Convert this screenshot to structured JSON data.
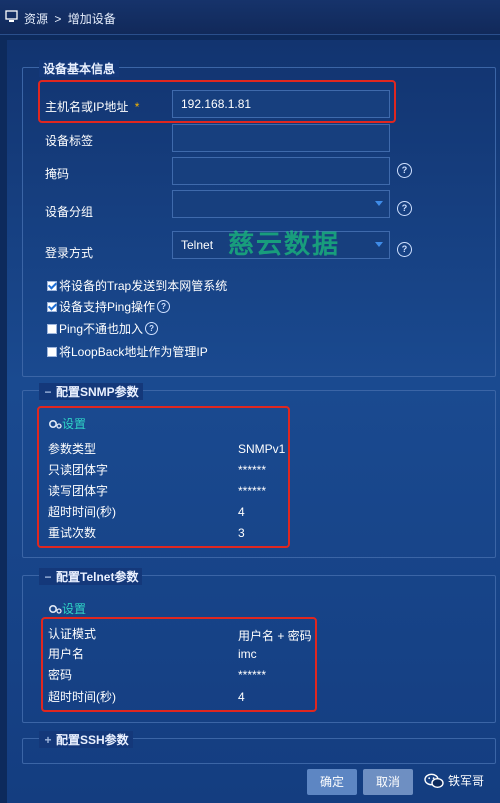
{
  "breadcrumb": {
    "root": "资源",
    "separator": ">",
    "current": "增加设备"
  },
  "basic_info": {
    "legend": "设备基本信息",
    "fields": [
      {
        "label": "主机名或IP地址",
        "required_mark": "*",
        "value": "192.168.1.81"
      },
      {
        "label": "设备标签",
        "value": ""
      },
      {
        "label": "掩码",
        "value": ""
      },
      {
        "label": "设备分组",
        "value": ""
      },
      {
        "label": "登录方式",
        "value": "Telnet"
      }
    ],
    "options": [
      {
        "label": "将设备的Trap发送到本网管系统",
        "checked": true
      },
      {
        "label": "设备支持Ping操作",
        "checked": true
      },
      {
        "label": "Ping不通也加入",
        "checked": false
      },
      {
        "label": "将LoopBack地址作为管理IP",
        "checked": false
      }
    ]
  },
  "snmp": {
    "legend": "配置SNMP参数",
    "toggle": "−",
    "settings_label": "设置",
    "rows": [
      {
        "key": "参数类型",
        "value": "SNMPv1"
      },
      {
        "key": "只读团体字",
        "value": "******"
      },
      {
        "key": "读写团体字",
        "value": "******"
      },
      {
        "key": "超时时间(秒)",
        "value": "4"
      },
      {
        "key": "重试次数",
        "value": "3"
      }
    ]
  },
  "telnet": {
    "legend": "配置Telnet参数",
    "toggle": "−",
    "settings_label": "设置",
    "rows": [
      {
        "key": "认证模式",
        "value": "用户名 + 密码"
      },
      {
        "key": "用户名",
        "value": "imc"
      },
      {
        "key": "密码",
        "value": "******"
      },
      {
        "key": "超时时间(秒)",
        "value": "4"
      }
    ]
  },
  "ssh": {
    "legend": "配置SSH参数",
    "toggle": "+"
  },
  "buttons": {
    "ok": "确定",
    "cancel": "取消"
  },
  "watermark": "慈云数据",
  "wechat_label": "铁军哥",
  "colors": {
    "accent_red": "#e0271f",
    "settings_teal": "#2fd4c6",
    "background": "#0d2a5c"
  }
}
